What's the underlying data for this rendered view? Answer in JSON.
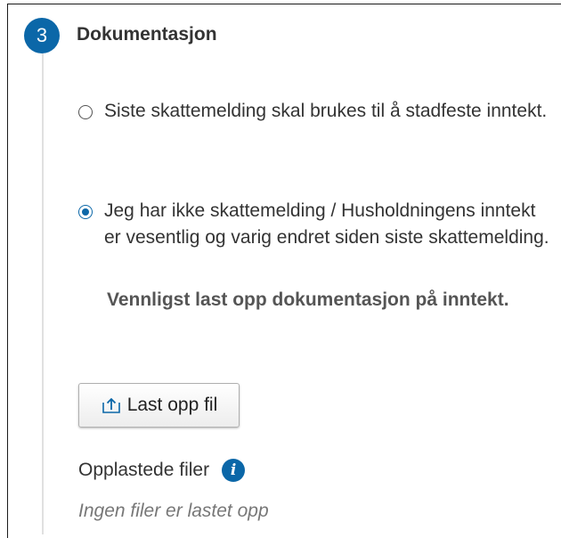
{
  "step": {
    "number": "3",
    "title": "Dokumentasjon"
  },
  "options": [
    {
      "label": "Siste skattemelding skal brukes til å stadfeste inntekt.",
      "selected": false
    },
    {
      "label": "Jeg har ikke skattemelding / Husholdningens inntekt er vesentlig og varig endret siden siste skattemelding.",
      "selected": true
    }
  ],
  "note": "Vennligst last opp dokumentasjon på inntekt.",
  "upload": {
    "button_label": "Last opp fil",
    "icon": "upload-icon"
  },
  "files": {
    "label": "Opplastede filer",
    "info_icon": "info-icon",
    "empty_text": "Ingen filer er lastet opp"
  },
  "colors": {
    "accent": "#0b67a8",
    "text": "#333333",
    "muted": "#777777"
  }
}
